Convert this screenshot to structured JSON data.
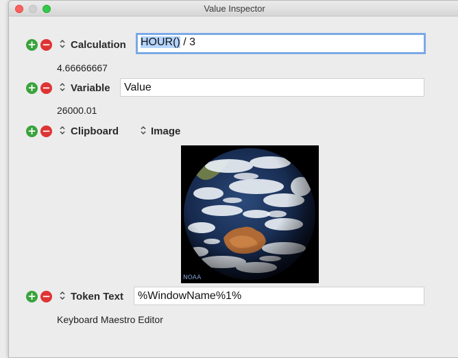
{
  "window": {
    "title": "Value Inspector"
  },
  "rows": {
    "calculation": {
      "label": "Calculation",
      "field_value_selected": "HOUR()",
      "field_value_rest": " / 3",
      "result": "4.66666667"
    },
    "variable": {
      "label": "Variable",
      "field_value": "Value",
      "result": "26000.01"
    },
    "clipboard": {
      "label": "Clipboard",
      "format_label": "Image"
    },
    "token_text": {
      "label": "Token Text",
      "field_value": "%WindowName%1%",
      "result": "Keyboard Maestro Editor"
    }
  },
  "icons": {
    "add": "+",
    "remove": "−",
    "stepper": "⌃⌄"
  },
  "image_caption": "NOAA",
  "colors": {
    "add_green": "#3aa33c",
    "remove_red": "#de3434",
    "focus_ring": "#7aa9e6",
    "selection": "#b5d4fe"
  }
}
